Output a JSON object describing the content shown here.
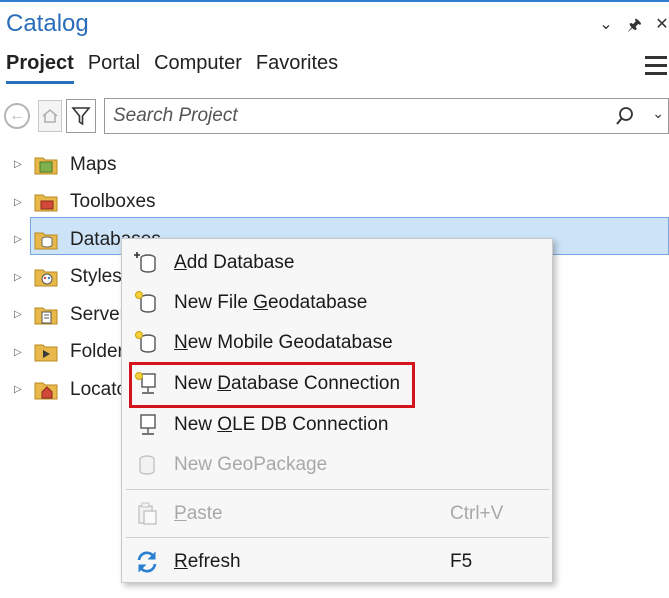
{
  "window": {
    "title": "Catalog"
  },
  "tabs": [
    {
      "label": "Project",
      "active": true
    },
    {
      "label": "Portal",
      "active": false
    },
    {
      "label": "Computer",
      "active": false
    },
    {
      "label": "Favorites",
      "active": false
    }
  ],
  "search": {
    "placeholder": "Search Project"
  },
  "tree": {
    "items": [
      {
        "label": "Maps",
        "icon": "maps-folder-icon"
      },
      {
        "label": "Toolboxes",
        "icon": "toolbox-folder-icon"
      },
      {
        "label": "Databases",
        "icon": "database-folder-icon",
        "selected": true
      },
      {
        "label": "Styles",
        "icon": "styles-folder-icon"
      },
      {
        "label": "Servers",
        "icon": "servers-folder-icon"
      },
      {
        "label": "Folders",
        "icon": "folders-folder-icon"
      },
      {
        "label": "Locators",
        "icon": "locators-folder-icon"
      }
    ]
  },
  "context_menu": {
    "add_database": {
      "pre": "",
      "ul": "A",
      "post": "dd Database"
    },
    "new_file_gdb": {
      "pre": "New File ",
      "ul": "G",
      "post": "eodatabase"
    },
    "new_mobile_gdb": {
      "pre": "",
      "ul": "N",
      "post": "ew Mobile Geodatabase"
    },
    "new_db_connection": {
      "pre": "New ",
      "ul": "D",
      "post": "atabase Connection"
    },
    "new_oledb_connection": {
      "pre": "New ",
      "ul": "O",
      "post": "LE DB Connection"
    },
    "new_geopackage": {
      "label": "New GeoPackage"
    },
    "paste": {
      "pre": "",
      "ul": "P",
      "post": "aste",
      "shortcut": "Ctrl+V"
    },
    "refresh": {
      "pre": "",
      "ul": "R",
      "post": "efresh",
      "shortcut": "F5"
    }
  },
  "colors": {
    "accent": "#2a6ebb",
    "selection": "#cde3f7",
    "highlight_box": "#d4141c"
  }
}
